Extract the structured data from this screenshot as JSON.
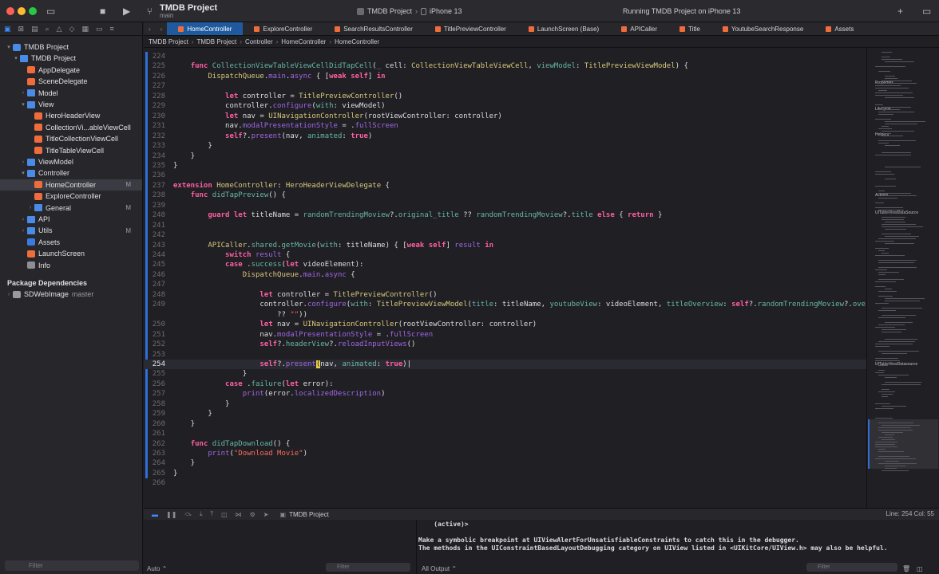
{
  "window": {
    "project_name": "TMDB Project",
    "branch": "main",
    "scheme": "TMDB Project",
    "device": "iPhone 13",
    "status": "Running TMDB Project on iPhone 13"
  },
  "navigator": {
    "items": [
      {
        "label": "TMDB Project",
        "kind": "proj",
        "indent": 0,
        "arrow": "▾"
      },
      {
        "label": "TMDB Project",
        "kind": "folder",
        "indent": 1,
        "arrow": "▾"
      },
      {
        "label": "AppDelegate",
        "kind": "swift",
        "indent": 2,
        "arrow": ""
      },
      {
        "label": "SceneDelegate",
        "kind": "swift",
        "indent": 2,
        "arrow": ""
      },
      {
        "label": "Model",
        "kind": "folder",
        "indent": 2,
        "arrow": "›"
      },
      {
        "label": "View",
        "kind": "folder",
        "indent": 2,
        "arrow": "▾"
      },
      {
        "label": "HeroHeaderView",
        "kind": "swift",
        "indent": 3,
        "arrow": ""
      },
      {
        "label": "CollectionVi...ableViewCell",
        "kind": "swift",
        "indent": 3,
        "arrow": ""
      },
      {
        "label": "TitleCollectionViewCell",
        "kind": "swift",
        "indent": 3,
        "arrow": ""
      },
      {
        "label": "TitleTableViewCell",
        "kind": "swift",
        "indent": 3,
        "arrow": ""
      },
      {
        "label": "ViewModel",
        "kind": "folder",
        "indent": 2,
        "arrow": "›"
      },
      {
        "label": "Controller",
        "kind": "folder",
        "indent": 2,
        "arrow": "▾"
      },
      {
        "label": "HomeController",
        "kind": "swift",
        "indent": 3,
        "arrow": "",
        "badge": "M",
        "selected": true
      },
      {
        "label": "ExploreController",
        "kind": "swift",
        "indent": 3,
        "arrow": ""
      },
      {
        "label": "General",
        "kind": "folder",
        "indent": 3,
        "arrow": "›",
        "badge": "M"
      },
      {
        "label": "API",
        "kind": "folder",
        "indent": 2,
        "arrow": "›"
      },
      {
        "label": "Utils",
        "kind": "folder",
        "indent": 2,
        "arrow": "›",
        "badge": "M"
      },
      {
        "label": "Assets",
        "kind": "asset",
        "indent": 2,
        "arrow": ""
      },
      {
        "label": "LaunchScreen",
        "kind": "swift",
        "indent": 2,
        "arrow": ""
      },
      {
        "label": "Info",
        "kind": "plist",
        "indent": 2,
        "arrow": ""
      }
    ],
    "package_header": "Package Dependencies",
    "package": {
      "label": "SDWebImage",
      "version": "master"
    },
    "filter_placeholder": "Filter"
  },
  "tabs": [
    {
      "label": "HomeController",
      "active": true
    },
    {
      "label": "ExploreController"
    },
    {
      "label": "SearchResultsController"
    },
    {
      "label": "TitlePreviewController"
    },
    {
      "label": "LaunchScreen (Base)"
    },
    {
      "label": "APICaller"
    },
    {
      "label": "Title"
    },
    {
      "label": "YoutubeSearchResponse"
    },
    {
      "label": "Assets"
    }
  ],
  "breadcrumb": [
    "TMDB Project",
    "TMDB Project",
    "Controller",
    "HomeController",
    "HomeController"
  ],
  "editor": {
    "current_line": 254,
    "lines": [
      {
        "n": 224,
        "h": ""
      },
      {
        "n": 225,
        "h": "    <span class='kw'>func</span> <span class='fn'>CollectionViewTableViewCellDidTapCell</span>(<span class='fn'>_</span> cell: <span class='ty'>CollectionViewTableViewCell</span>, <span class='fn'>viewModel</span>: <span class='ty'>TitlePreviewViewModel</span>) {"
      },
      {
        "n": 226,
        "h": "        <span class='ty'>DispatchQueue</span>.<span class='pm'>main</span>.<span class='pm'>async</span> { [<span class='kw'>weak self</span>] <span class='kw'>in</span>"
      },
      {
        "n": 227,
        "h": ""
      },
      {
        "n": 228,
        "h": "            <span class='kw'>let</span> controller = <span class='ty'>TitlePreviewController</span>()"
      },
      {
        "n": 229,
        "h": "            controller.<span class='pm'>configure</span>(<span class='fn'>with</span>: viewModel)"
      },
      {
        "n": 230,
        "h": "            <span class='kw'>let</span> nav = <span class='ty'>UINavigationController</span>(rootViewController: controller)"
      },
      {
        "n": 231,
        "h": "            nav.<span class='pm'>modalPresentationStyle</span> = .<span class='pm'>fullScreen</span>"
      },
      {
        "n": 232,
        "h": "            <span class='kw'>self</span>?.<span class='pm'>present</span>(nav, <span class='fn'>animated</span>: <span class='kw'>true</span>)"
      },
      {
        "n": 233,
        "h": "        }"
      },
      {
        "n": 234,
        "h": "    }"
      },
      {
        "n": 235,
        "h": "}"
      },
      {
        "n": 236,
        "h": ""
      },
      {
        "n": 237,
        "h": "<span class='kw'>extension</span> <span class='ty'>HomeController</span>: <span class='ty'>HeroHeaderViewDelegate</span> {"
      },
      {
        "n": 238,
        "h": "    <span class='kw'>func</span> <span class='fn'>didTapPreview</span>() {"
      },
      {
        "n": 239,
        "h": ""
      },
      {
        "n": 240,
        "h": "        <span class='kw'>guard let</span> titleName = <span class='fn'>randomTrendingMoview</span>?.<span class='fn'>original_title</span> ?? <span class='fn'>randomTrendingMoview</span>?.<span class='fn'>title</span> <span class='kw'>else</span> { <span class='kw'>return</span> }"
      },
      {
        "n": 241,
        "h": ""
      },
      {
        "n": 242,
        "h": ""
      },
      {
        "n": 243,
        "h": "        <span class='ty'>APICaller</span>.<span class='fn'>shared</span>.<span class='fn'>getMovie</span>(<span class='fn'>with</span>: titleName) { [<span class='kw'>weak self</span>] <span class='pm'>result</span> <span class='kw'>in</span>"
      },
      {
        "n": 244,
        "h": "            <span class='kw'>switch</span> <span class='pm'>result</span> {"
      },
      {
        "n": 245,
        "h": "            <span class='kw'>case</span> .<span class='fn'>success</span>(<span class='kw'>let</span> videoElement):"
      },
      {
        "n": 246,
        "h": "                <span class='ty'>DispatchQueue</span>.<span class='pm'>main</span>.<span class='pm'>async</span> {"
      },
      {
        "n": 247,
        "h": ""
      },
      {
        "n": 248,
        "h": "                    <span class='kw'>let</span> controller = <span class='ty'>TitlePreviewController</span>()"
      },
      {
        "n": 249,
        "h": "                    controller.<span class='pm'>configure</span>(<span class='fn'>with</span>: <span class='ty'>TitlePreviewViewModel</span>(<span class='fn'>title</span>: titleName, <span class='fn'>youtubeView</span>: videoElement, <span class='fn'>titleOverview</span>: <span class='kw'>self</span>?.<span class='fn'>randomTrendingMoview</span>?.<span class='fn'>overview</span>"
      },
      {
        "n": 0,
        "h": "                        ?? <span class='st'>\"\"</span>))"
      },
      {
        "n": 250,
        "h": "                    <span class='kw'>let</span> nav = <span class='ty'>UINavigationController</span>(rootViewController: controller)"
      },
      {
        "n": 251,
        "h": "                    nav.<span class='pm'>modalPresentationStyle</span> = .<span class='pm'>fullScreen</span>"
      },
      {
        "n": 252,
        "h": "                    <span class='kw'>self</span>?.<span class='fn'>headerView</span>?.<span class='pm'>reloadInputViews</span>()"
      },
      {
        "n": 253,
        "h": ""
      },
      {
        "n": 254,
        "h": "                    <span class='kw'>self</span>?.<span class='pm'>present</span><span class='cursor-mark'>(</span>nav, <span class='fn'>animated</span>: <span class='kw'>true</span>)|"
      },
      {
        "n": 255,
        "h": "                }"
      },
      {
        "n": 256,
        "h": "            <span class='kw'>case</span> .<span class='fn'>failure</span>(<span class='kw'>let</span> error):"
      },
      {
        "n": 257,
        "h": "                <span class='pm'>print</span>(error.<span class='pm'>localizedDescription</span>)"
      },
      {
        "n": 258,
        "h": "            }"
      },
      {
        "n": 259,
        "h": "        }"
      },
      {
        "n": 260,
        "h": "    }"
      },
      {
        "n": 261,
        "h": ""
      },
      {
        "n": 262,
        "h": "    <span class='kw'>func</span> <span class='fn'>didTapDownload</span>() {"
      },
      {
        "n": 263,
        "h": "        <span class='pm'>print</span>(<span class='st'>\"Download Movie\"</span>)"
      },
      {
        "n": 264,
        "h": "    }"
      },
      {
        "n": 265,
        "h": "}"
      },
      {
        "n": 266,
        "h": ""
      }
    ]
  },
  "minimap": {
    "labels": [
      "Properties",
      "Lifecycle",
      "Helpers",
      "Actions",
      "UITableViewDataSource",
      "UITableViewDatasource"
    ]
  },
  "debug": {
    "target": "TMDB Project",
    "position": "Line: 254  Col: 55"
  },
  "console": {
    "lines": [
      "    (active)>",
      "",
      "Make a symbolic breakpoint at UIViewAlertForUnsatisfiableConstraints to catch this in the debugger.",
      "The methods in the UIConstraintBasedLayoutDebugging category on UIView listed in <UIKitCore/UIView.h> may also be helpful."
    ],
    "auto_label": "Auto ⌃",
    "output_label": "All Output ⌃",
    "filter_placeholder": "Filter"
  },
  "colors": {
    "accent": "#3d8dff",
    "selected_tab": "#1f5a9e",
    "keyword": "#ff5fa3"
  }
}
